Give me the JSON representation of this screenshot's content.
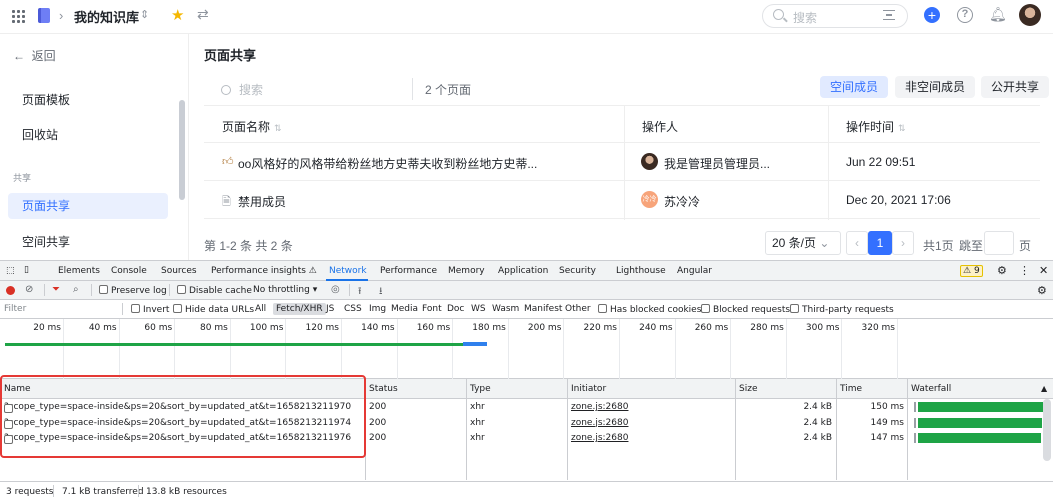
{
  "topbar": {
    "library_title": "我的知识库",
    "search_placeholder": "搜索",
    "icons": [
      "grid-icon",
      "book-icon",
      "chevron-right-icon",
      "chevron-updown-icon",
      "star-icon",
      "swap-icon",
      "search-icon",
      "filter-icon",
      "plus-icon",
      "help-icon",
      "bell-icon",
      "avatar"
    ]
  },
  "sidebar": {
    "back_label": "返回",
    "items": [
      {
        "label": "页面模板"
      },
      {
        "label": "回收站"
      }
    ],
    "group_label": "共享",
    "shared_items": [
      {
        "label": "页面共享",
        "active": true
      },
      {
        "label": "空间共享",
        "active": false
      }
    ]
  },
  "main": {
    "title": "页面共享",
    "search_placeholder": "搜索",
    "page_count": "2 个页面",
    "tabs": [
      {
        "label": "空间成员",
        "active": true
      },
      {
        "label": "非空间成员",
        "active": false
      },
      {
        "label": "公开共享",
        "active": false
      }
    ],
    "columns": {
      "name": "页面名称",
      "operator": "操作人",
      "time": "操作时间"
    },
    "rows": [
      {
        "icon": "thumb-icon",
        "name": "oo风格好的风格带给粉丝地方史蒂夫收到粉丝地方史蒂...",
        "operator": "我是管理员管理员...",
        "time": "Jun 22 09:51"
      },
      {
        "icon": "doc-icon",
        "name": "禁用成员",
        "operator": "苏冷冷",
        "operator_avatar_text": "冷冷",
        "time": "Dec 20, 2021 17:06"
      }
    ],
    "pager": {
      "range_text": "第 1-2 条  共 2 条",
      "page_size": "20 条/页",
      "current_page": "1",
      "total_pages": "共1页",
      "jump_label": "跳至",
      "page_suffix": "页"
    }
  },
  "devtools": {
    "tabs": [
      "Elements",
      "Console",
      "Sources",
      "Performance insights ⚠",
      "Network",
      "Performance",
      "Memory",
      "Application",
      "Security",
      "Lighthouse",
      "Angular"
    ],
    "active_tab": "Network",
    "warning_count": "9",
    "toolbar": {
      "preserve_log": "Preserve log",
      "disable_cache": "Disable cache",
      "throttling": "No throttling"
    },
    "filter": {
      "placeholder": "Filter",
      "invert": "Invert",
      "hide_data_urls": "Hide data URLs",
      "types": [
        "All",
        "Fetch/XHR",
        "JS",
        "CSS",
        "Img",
        "Media",
        "Font",
        "Doc",
        "WS",
        "Wasm",
        "Manifest",
        "Other"
      ],
      "active_type": "Fetch/XHR",
      "has_blocked_cookies": "Has blocked cookies",
      "blocked_requests": "Blocked requests",
      "third_party": "Third-party requests"
    },
    "timeline_ticks": [
      "20 ms",
      "40 ms",
      "60 ms",
      "80 ms",
      "100 ms",
      "120 ms",
      "140 ms",
      "160 ms",
      "180 ms",
      "200 ms",
      "220 ms",
      "240 ms",
      "260 ms",
      "280 ms",
      "300 ms",
      "320 ms"
    ],
    "columns": [
      "Name",
      "Status",
      "Type",
      "Initiator",
      "Size",
      "Time",
      "Waterfall"
    ],
    "requests": [
      {
        "name": "?scope_type=space-inside&ps=20&sort_by=updated_at&t=1658213211970",
        "status": "200",
        "type": "xhr",
        "initiator": "zone.js:2680",
        "size": "2.4 kB",
        "time": "150 ms",
        "time_ms": 150
      },
      {
        "name": "?scope_type=space-inside&ps=20&sort_by=updated_at&t=1658213211974",
        "status": "200",
        "type": "xhr",
        "initiator": "zone.js:2680",
        "size": "2.4 kB",
        "time": "149 ms",
        "time_ms": 149
      },
      {
        "name": "?scope_type=space-inside&ps=20&sort_by=updated_at&t=1658213211976",
        "status": "200",
        "type": "xhr",
        "initiator": "zone.js:2680",
        "size": "2.4 kB",
        "time": "147 ms",
        "time_ms": 147
      }
    ],
    "status_bar": {
      "requests": "3 requests",
      "transferred": "7.1 kB transferred",
      "resources": "13.8 kB resources"
    },
    "colors": {
      "accent": "#1a73e8",
      "waterfall": "#1ea446",
      "highlight": "#e53935"
    }
  }
}
